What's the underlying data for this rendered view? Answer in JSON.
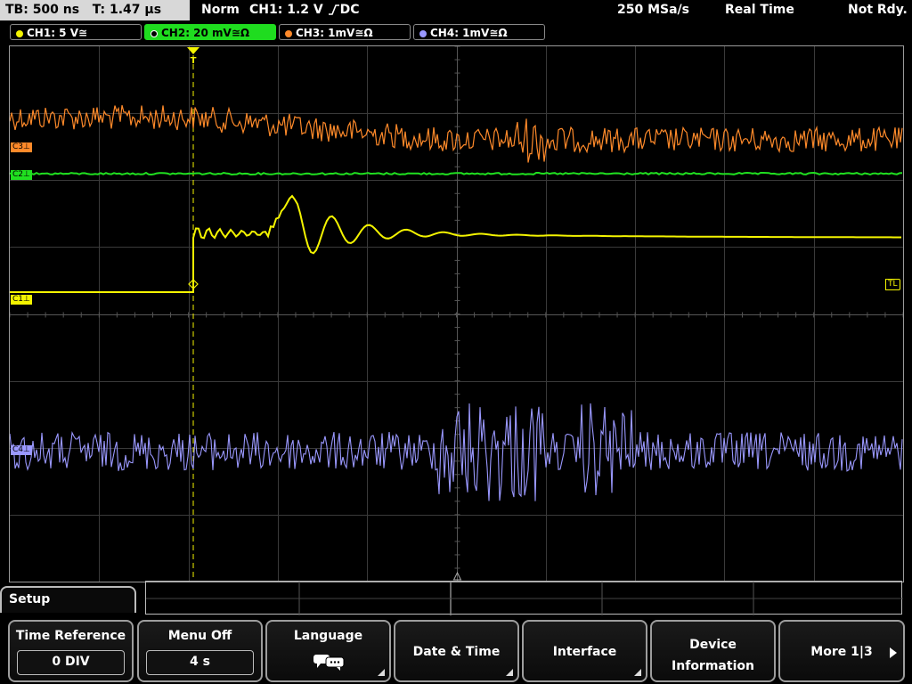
{
  "status": {
    "timebase": "TB: 500 ns",
    "time_offset": "T: 1.47 µs",
    "trigger_mode": "Norm",
    "trigger_info": "CH1: 1.2 V",
    "trigger_coupling": "DC",
    "sample_rate": "250 MSa/s",
    "acq_mode": "Real Time",
    "state": "Not Rdy."
  },
  "channels": [
    {
      "label": "CH1: 5 V",
      "coupling": "≅",
      "color": "#f4f400"
    },
    {
      "label": "CH2: 20 mV",
      "coupling": "≅Ω",
      "color": "#20e020"
    },
    {
      "label": "CH3: 1mV",
      "coupling": "≅Ω",
      "color": "#ff8a2a"
    },
    {
      "label": "CH4: 1mV",
      "coupling": "≅Ω",
      "color": "#9a98ff"
    }
  ],
  "markers": {
    "c3": "C3",
    "c2": "C2",
    "c1": "C1",
    "c4": "C4",
    "trigger_level": "TL",
    "trigger_pos": "T"
  },
  "menu": {
    "title": "Setup",
    "softkeys": [
      {
        "label": "Time Reference",
        "value": "0 DIV"
      },
      {
        "label": "Menu Off",
        "value": "4 s"
      },
      {
        "label": "Language",
        "icon": "speech-bubbles-icon"
      },
      {
        "label": "Date & Time"
      },
      {
        "label": "Interface"
      },
      {
        "label": "Device\nInformation"
      },
      {
        "label": "More 1|3"
      }
    ]
  }
}
